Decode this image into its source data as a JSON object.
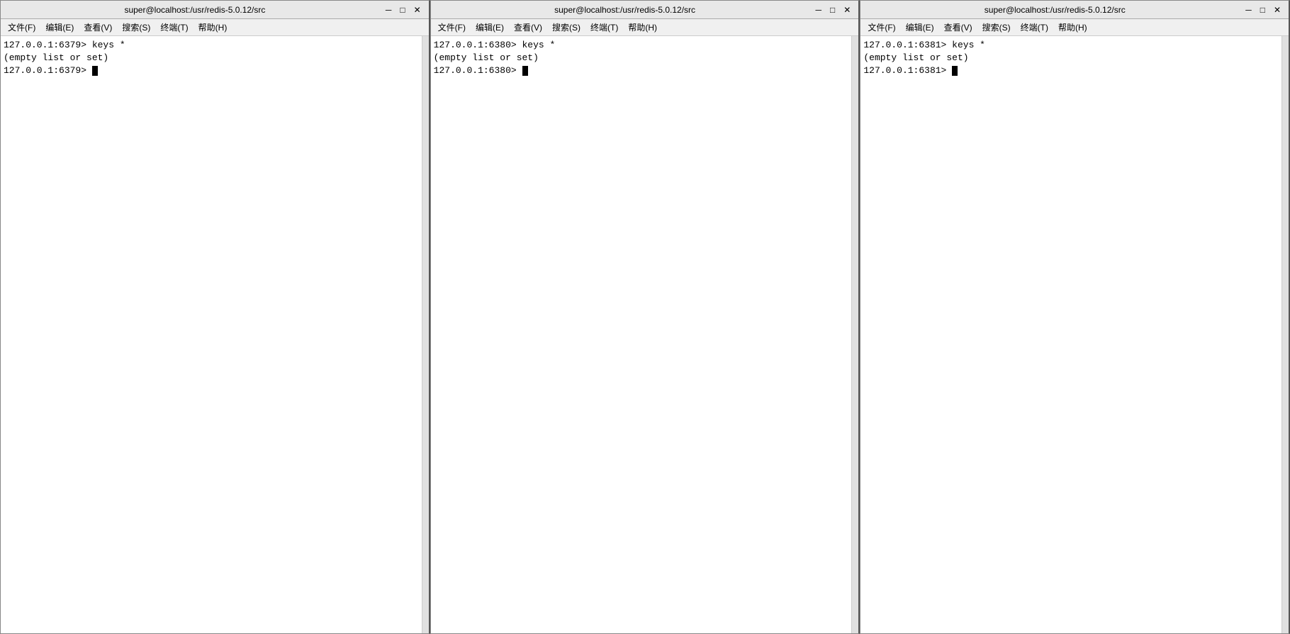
{
  "windows": [
    {
      "id": "win1",
      "title": "super@localhost:/usr/redis-5.0.12/src",
      "menu": [
        {
          "label": "文件(F)"
        },
        {
          "label": "编辑(E)"
        },
        {
          "label": "查看(V)"
        },
        {
          "label": "搜索(S)"
        },
        {
          "label": "终端(T)"
        },
        {
          "label": "帮助(H)"
        }
      ],
      "content": "127.0.0.1:6379> keys *\n(empty list or set)\n127.0.0.1:6379> ",
      "has_cursor": true
    },
    {
      "id": "win2",
      "title": "super@localhost:/usr/redis-5.0.12/src",
      "menu": [
        {
          "label": "文件(F)"
        },
        {
          "label": "编辑(E)"
        },
        {
          "label": "查看(V)"
        },
        {
          "label": "搜索(S)"
        },
        {
          "label": "终端(T)"
        },
        {
          "label": "帮助(H)"
        }
      ],
      "content": "127.0.0.1:6380> keys *\n(empty list or set)\n127.0.0.1:6380> ",
      "has_cursor": true
    },
    {
      "id": "win3",
      "title": "super@localhost:/usr/redis-5.0.12/src",
      "menu": [
        {
          "label": "文件(F)"
        },
        {
          "label": "编辑(E)"
        },
        {
          "label": "查看(V)"
        },
        {
          "label": "搜索(S)"
        },
        {
          "label": "终端(T)"
        },
        {
          "label": "帮助(H)"
        }
      ],
      "content": "127.0.0.1:6381> keys *\n(empty list or set)\n127.0.0.1:6381> ",
      "has_cursor": true
    }
  ],
  "controls": {
    "minimize": "─",
    "maximize": "□",
    "close": "✕"
  }
}
